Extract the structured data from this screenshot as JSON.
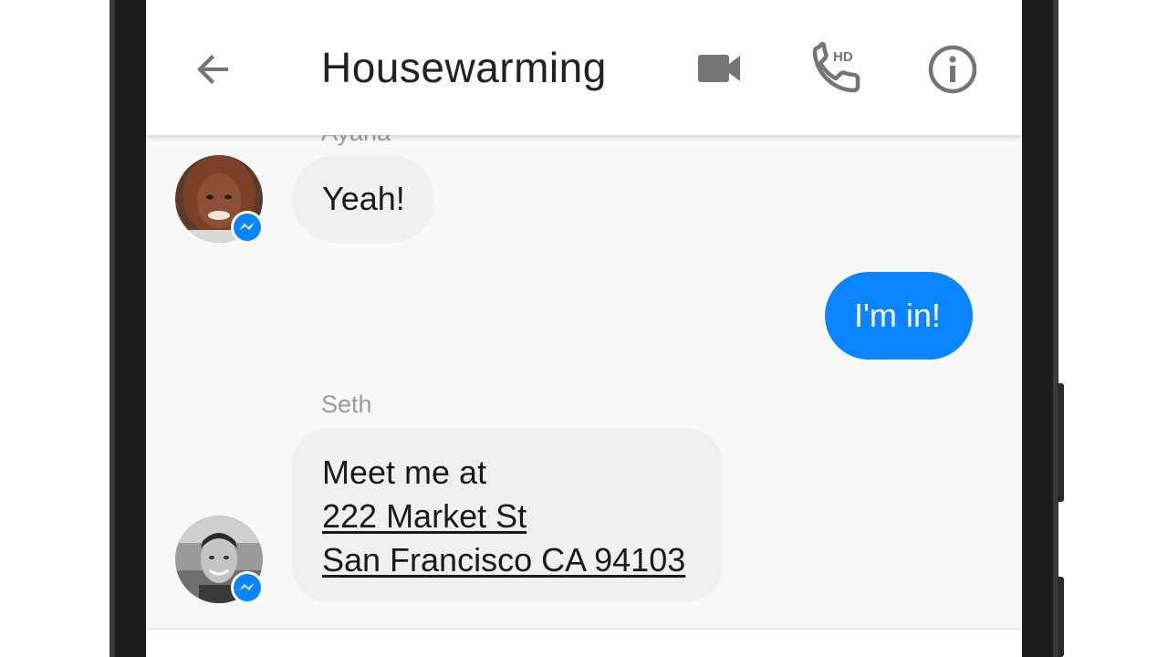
{
  "conversation": {
    "title": "Housewarming",
    "icons": {
      "back": "arrow-left-icon",
      "video": "video-camera-icon",
      "hd_call": "hd-phone-icon",
      "info": "info-icon",
      "badge": "messenger-badge-icon"
    },
    "hd_label": "HD"
  },
  "messages": [
    {
      "sender": "Ayana",
      "text": "Yeah!",
      "direction": "incoming"
    },
    {
      "text": "I'm in!",
      "direction": "outgoing"
    },
    {
      "sender": "Seth",
      "direction": "incoming",
      "text_line": "Meet me at",
      "address_line1": "222 Market St",
      "address_line2": "San Francisco CA 94103"
    }
  ],
  "colors": {
    "outgoing_bubble": "#0a84ff",
    "incoming_bubble": "#f0f0f0",
    "messenger_badge": "#0a84ff",
    "header_icons": "#757575"
  }
}
